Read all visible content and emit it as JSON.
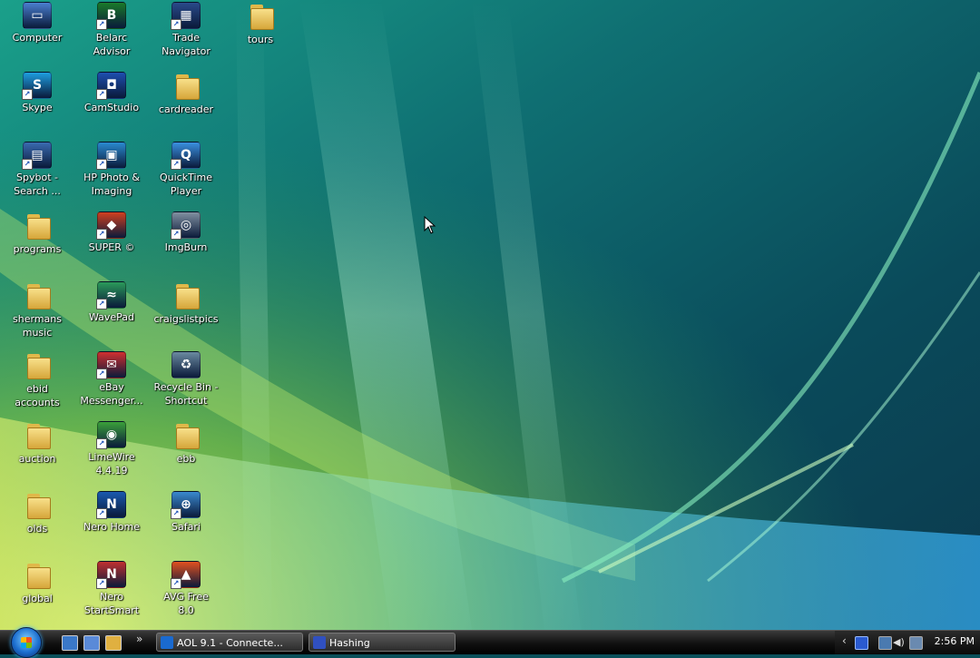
{
  "desktop": {
    "icons": [
      {
        "id": "computer",
        "label": "Computer",
        "type": "app",
        "color": "#4a7fd0",
        "glyph": "▭"
      },
      {
        "id": "belarc",
        "label": "Belarc\nAdvisor",
        "type": "app",
        "color": "#1a7a2a",
        "glyph": "B"
      },
      {
        "id": "trade",
        "label": "Trade\nNavigator",
        "type": "app",
        "color": "#2a4a8a",
        "glyph": "▦"
      },
      {
        "id": "tours",
        "label": "tours",
        "type": "folder"
      },
      {
        "id": "skype",
        "label": "Skype",
        "type": "app",
        "color": "#1e9ee0",
        "glyph": "S"
      },
      {
        "id": "camstudio",
        "label": "CamStudio",
        "type": "app",
        "color": "#1e4fb0",
        "glyph": "◘"
      },
      {
        "id": "cardreader",
        "label": "cardreader",
        "type": "folder"
      },
      {
        "id": "spybot",
        "label": "Spybot -\nSearch ...",
        "type": "app",
        "color": "#3a6ab0",
        "glyph": "▤"
      },
      {
        "id": "hpphoto",
        "label": "HP Photo &\nImaging",
        "type": "app",
        "color": "#2a8ad0",
        "glyph": "▣"
      },
      {
        "id": "quicktime",
        "label": "QuickTime\nPlayer",
        "type": "app",
        "color": "#3a90e0",
        "glyph": "Q"
      },
      {
        "id": "programs",
        "label": "programs",
        "type": "folder"
      },
      {
        "id": "super",
        "label": "SUPER ©",
        "type": "app",
        "color": "#d04020",
        "glyph": "◆"
      },
      {
        "id": "imgburn",
        "label": "ImgBurn",
        "type": "app",
        "color": "#8090a0",
        "glyph": "◎"
      },
      {
        "id": "shermans",
        "label": "shermans\nmusic",
        "type": "folder"
      },
      {
        "id": "wavepad",
        "label": "WavePad",
        "type": "app",
        "color": "#2a9a5a",
        "glyph": "≈"
      },
      {
        "id": "craigslistpics",
        "label": "craigslistpics",
        "type": "folder"
      },
      {
        "id": "ebid",
        "label": "ebid\naccounts",
        "type": "folder"
      },
      {
        "id": "ebay",
        "label": "eBay\nMessenger...",
        "type": "app",
        "color": "#d03030",
        "glyph": "✉"
      },
      {
        "id": "recycle",
        "label": "Recycle Bin -\nShortcut",
        "type": "app",
        "color": "#6a8aa0",
        "glyph": "♻"
      },
      {
        "id": "auction",
        "label": "auction",
        "type": "folder"
      },
      {
        "id": "limewire",
        "label": "LimeWire\n4.4.19",
        "type": "app",
        "color": "#3aa03a",
        "glyph": "◉"
      },
      {
        "id": "ebb",
        "label": "ebb",
        "type": "folder"
      },
      {
        "id": "olds",
        "label": "olds",
        "type": "folder"
      },
      {
        "id": "nerohome",
        "label": "Nero Home",
        "type": "app",
        "color": "#1a5ab0",
        "glyph": "N"
      },
      {
        "id": "safari",
        "label": "Safari",
        "type": "app",
        "color": "#3a8ad0",
        "glyph": "⊕"
      },
      {
        "id": "global",
        "label": "global",
        "type": "folder"
      },
      {
        "id": "nerostart",
        "label": "Nero\nStartSmart",
        "type": "app",
        "color": "#c03030",
        "glyph": "N"
      },
      {
        "id": "avg",
        "label": "AVG Free\n8.0",
        "type": "app",
        "color": "#e05020",
        "glyph": "▲"
      }
    ]
  },
  "taskbar": {
    "quick_launch": [
      {
        "name": "show-desktop-icon",
        "color": "#3a78c8"
      },
      {
        "name": "switch-windows-icon",
        "color": "#5a8ad8"
      },
      {
        "name": "folder-launch-icon",
        "color": "#e0b040"
      }
    ],
    "more_label": "»",
    "tasks": [
      {
        "label": "AOL 9.1 - Connecte...",
        "color": "#1a6ad0"
      },
      {
        "label": "Hashing",
        "color": "#3050c0"
      }
    ],
    "tray": {
      "chevron": "‹",
      "time": "2:56 PM"
    }
  }
}
